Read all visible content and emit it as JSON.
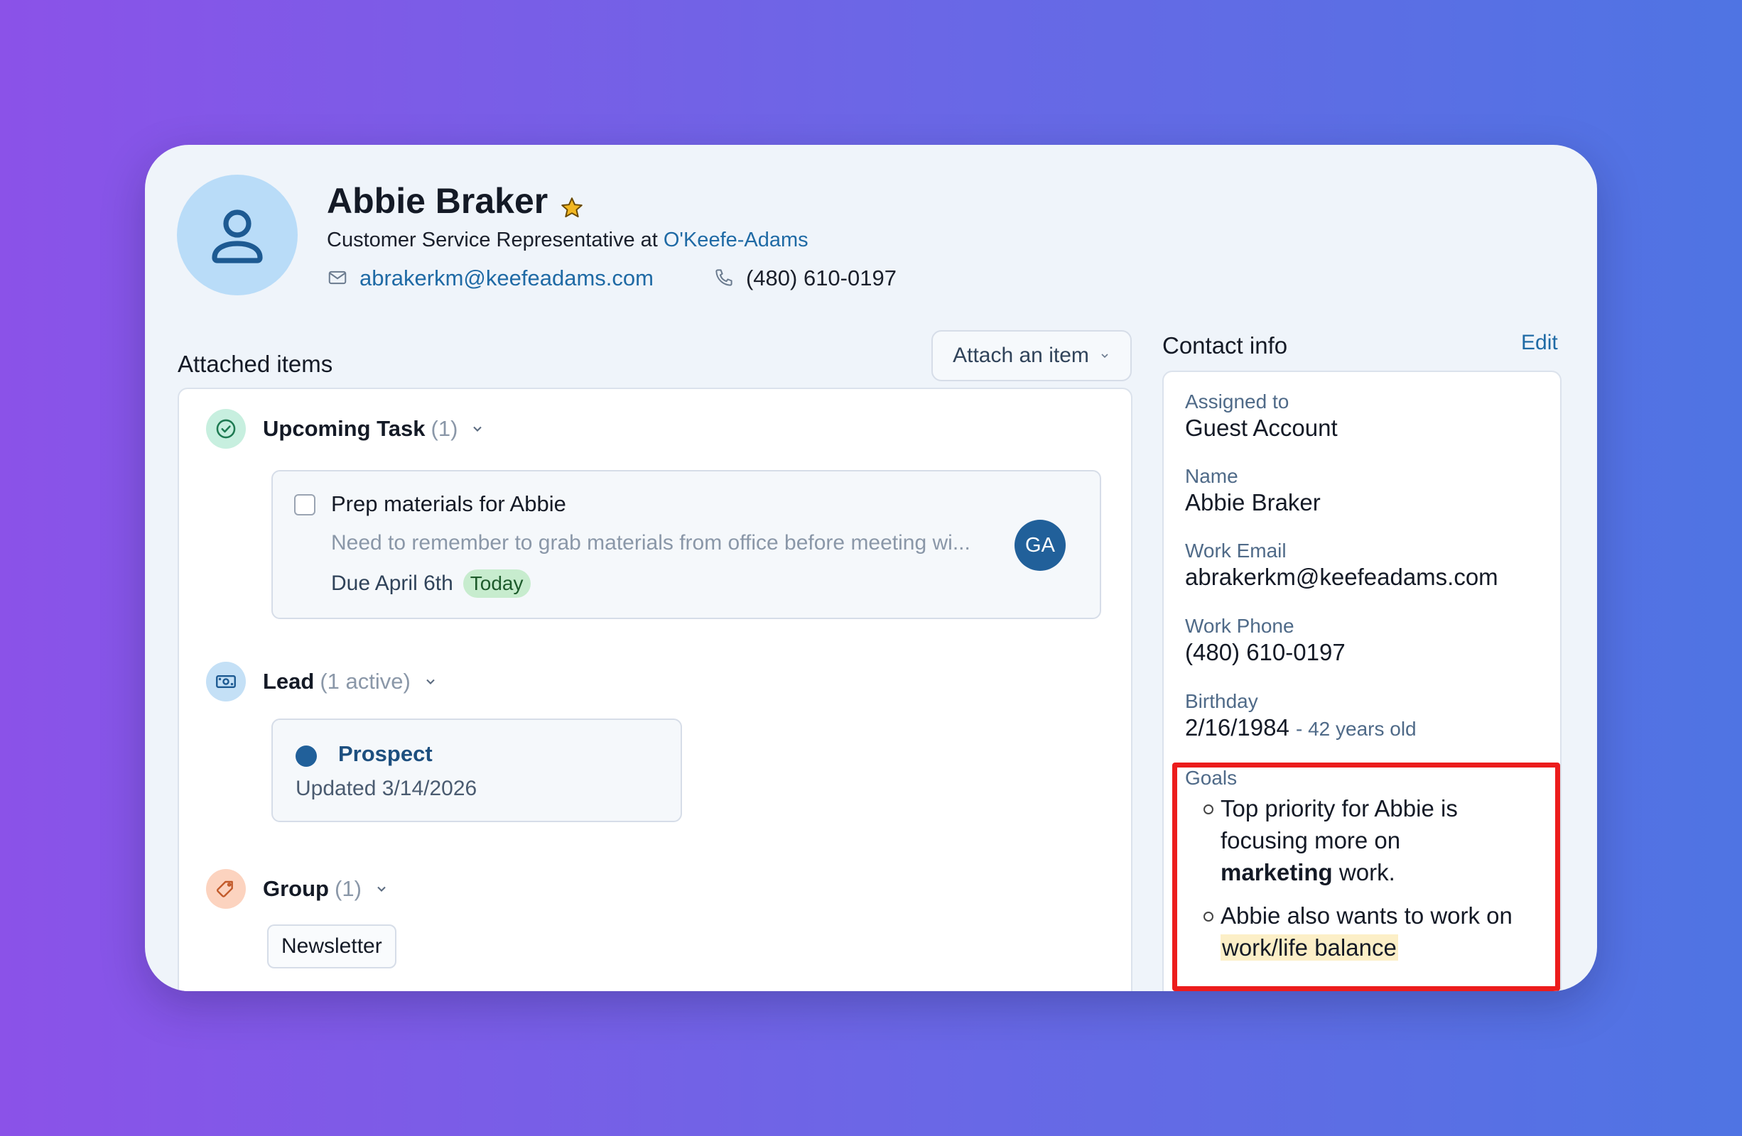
{
  "header": {
    "name": "Abbie Braker",
    "subtitle_prefix": "Customer Service Representative at",
    "company": "O'Keefe-Adams",
    "email": "abrakerkm@keefeadams.com",
    "phone": "(480) 610-0197"
  },
  "attached": {
    "title": "Attached items",
    "attach_button": "Attach an item",
    "task_section": {
      "label": "Upcoming Task",
      "count": "(1)"
    },
    "task": {
      "title": "Prep materials for Abbie",
      "description": "Need to remember to grab materials from office before meeting wi...",
      "due": "Due April 6th",
      "badge": "Today",
      "assignee_initials": "GA"
    },
    "lead_section": {
      "label": "Lead",
      "count": "(1 active)"
    },
    "lead": {
      "stage": "Prospect",
      "updated": "Updated 3/14/2026"
    },
    "group_section": {
      "label": "Group",
      "count": "(1)"
    },
    "group": {
      "chip": "Newsletter"
    }
  },
  "contact_info": {
    "title": "Contact info",
    "edit": "Edit",
    "assigned_label": "Assigned to",
    "assigned_value": "Guest Account",
    "name_label": "Name",
    "name_value": "Abbie Braker",
    "email_label": "Work Email",
    "email_value": "abrakerkm@keefeadams.com",
    "phone_label": "Work Phone",
    "phone_value": "(480) 610-0197",
    "birthday_label": "Birthday",
    "birthday_value": "2/16/1984",
    "birthday_age": "- 42 years old",
    "goals_label": "Goals",
    "goal1_part1": "Top priority for Abbie is focusing more on",
    "goal1_bold": "marketing",
    "goal1_part2": "work.",
    "goal2_part1": "Abbie also wants to work on",
    "goal2_highlight": "work/life balance"
  },
  "colors": {
    "accent": "#1f6aa5",
    "highlight_border": "#ec1c1c",
    "today_badge": "#c7ecce"
  }
}
